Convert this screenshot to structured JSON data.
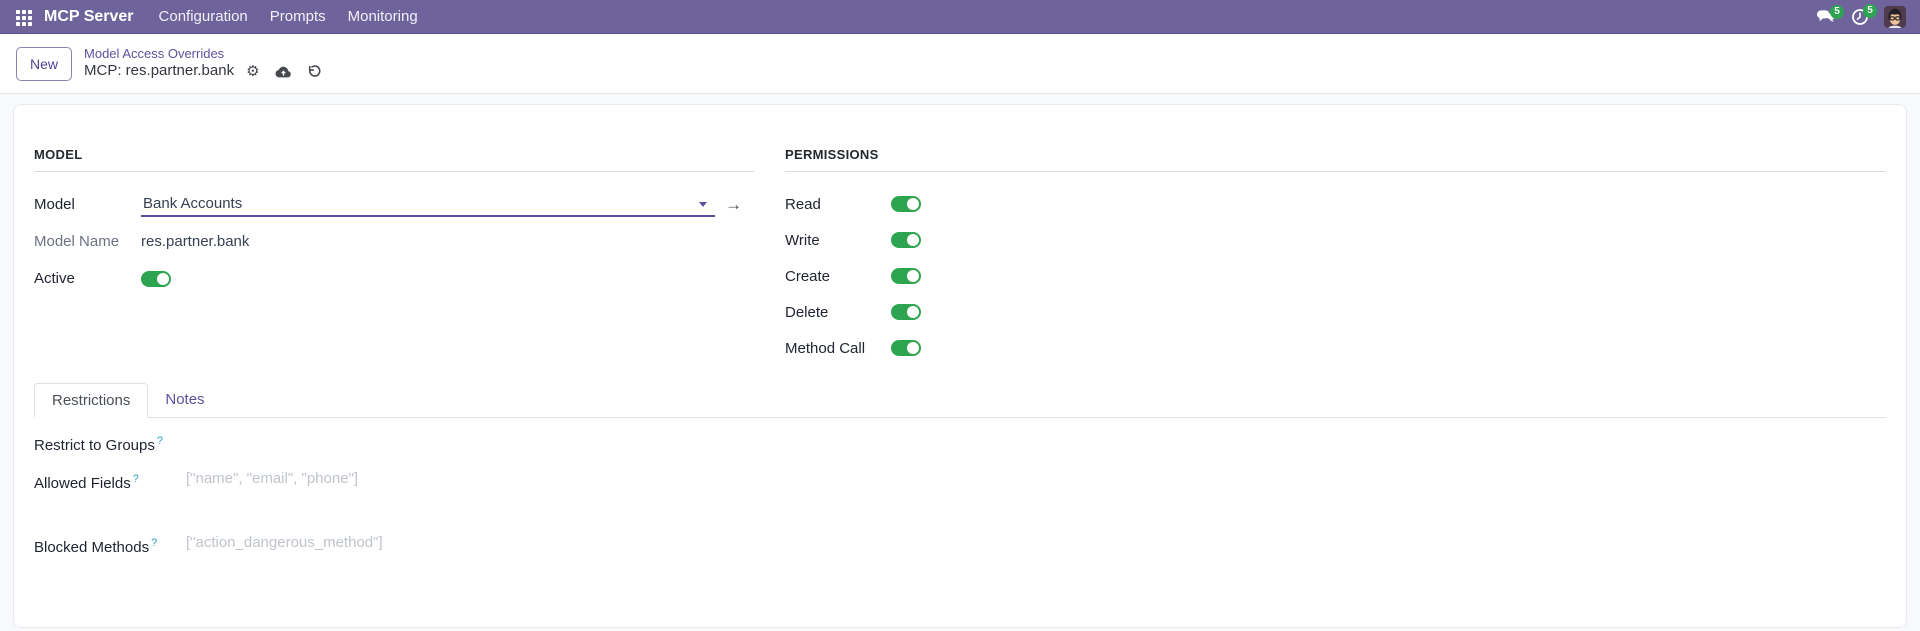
{
  "navbar": {
    "app_title": "MCP Server",
    "menus": [
      {
        "label": "Configuration"
      },
      {
        "label": "Prompts"
      },
      {
        "label": "Monitoring"
      }
    ],
    "messages_badge": "5",
    "activities_badge": "5",
    "icons": {
      "apps": "grid-icon",
      "messages": "chat-bubbles-icon",
      "activities": "clock-icon",
      "user": "avatar"
    },
    "color": "#6e649b"
  },
  "control_panel": {
    "new_button_label": "New",
    "breadcrumb_parent": "Model Access Overrides",
    "breadcrumb_current": "MCP: res.partner.bank",
    "record_action_icons": [
      "gear-icon",
      "cloud-upload-icon",
      "discard-icon"
    ]
  },
  "model_section": {
    "title": "MODEL",
    "model_label": "Model",
    "model_value": "Bank Accounts",
    "model_field_icons": [
      "chevron-down-icon",
      "internal-link-arrow-icon"
    ],
    "model_name_label": "Model Name",
    "model_name_value": "res.partner.bank",
    "active_label": "Active",
    "active": true
  },
  "permissions_section": {
    "title": "PERMISSIONS",
    "rows": [
      {
        "label": "Read",
        "enabled": true
      },
      {
        "label": "Write",
        "enabled": true
      },
      {
        "label": "Create",
        "enabled": true
      },
      {
        "label": "Delete",
        "enabled": true
      },
      {
        "label": "Method Call",
        "enabled": true
      }
    ]
  },
  "tabs": {
    "restrictions": "Restrictions",
    "notes": "Notes"
  },
  "restrictions_tab": {
    "help_symbol": "?",
    "restrict_to_groups_label": "Restrict to Groups",
    "allowed_fields_label": "Allowed Fields",
    "allowed_fields_placeholder": "[\"name\", \"email\", \"phone\"]",
    "blocked_methods_label": "Blocked Methods",
    "blocked_methods_placeholder": "[\"action_dangerous_method\"]"
  },
  "colors": {
    "accent_purple": "#5f51a0",
    "toggle_on_green": "#2da44f",
    "badge_green": "#2da44f"
  }
}
